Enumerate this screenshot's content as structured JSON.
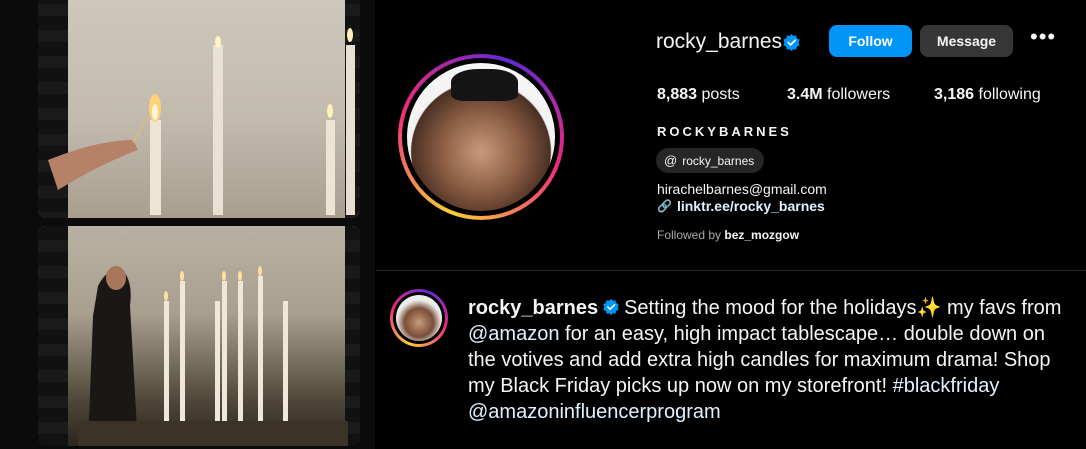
{
  "profile": {
    "username": "rocky_barnes",
    "follow_label": "Follow",
    "message_label": "Message",
    "more_label": "•••",
    "stats": {
      "posts_count": "8,883",
      "posts_label": "posts",
      "followers_count": "3.4M",
      "followers_label": "followers",
      "following_count": "3,186",
      "following_label": "following"
    },
    "display_name": "ROCKYBARNES",
    "threads_handle": "rocky_barnes",
    "email": "hirachelbarnes@gmail.com",
    "link": "linktr.ee/rocky_barnes",
    "followed_by_prefix": "Followed by",
    "followed_by_user": "bez_mozgow"
  },
  "caption": {
    "username": "rocky_barnes",
    "text_part1": "Setting the mood for the holidays✨  my favs from ",
    "mention1": "@amazon",
    "text_part2": " for an easy, high impact tablescape… double down on the votives and add extra high candles for maximum drama! Shop my Black Friday picks up now on my storefront! ",
    "hashtag": "#blackfriday",
    "mention2": "@amazoninfluencerprogram"
  },
  "colors": {
    "accent": "#0095f6",
    "link": "#e0f1ff",
    "secondary_button": "#363636",
    "background": "#000000"
  },
  "icons": [
    "verified-badge-icon",
    "threads-icon",
    "link-icon",
    "more-options-icon"
  ]
}
